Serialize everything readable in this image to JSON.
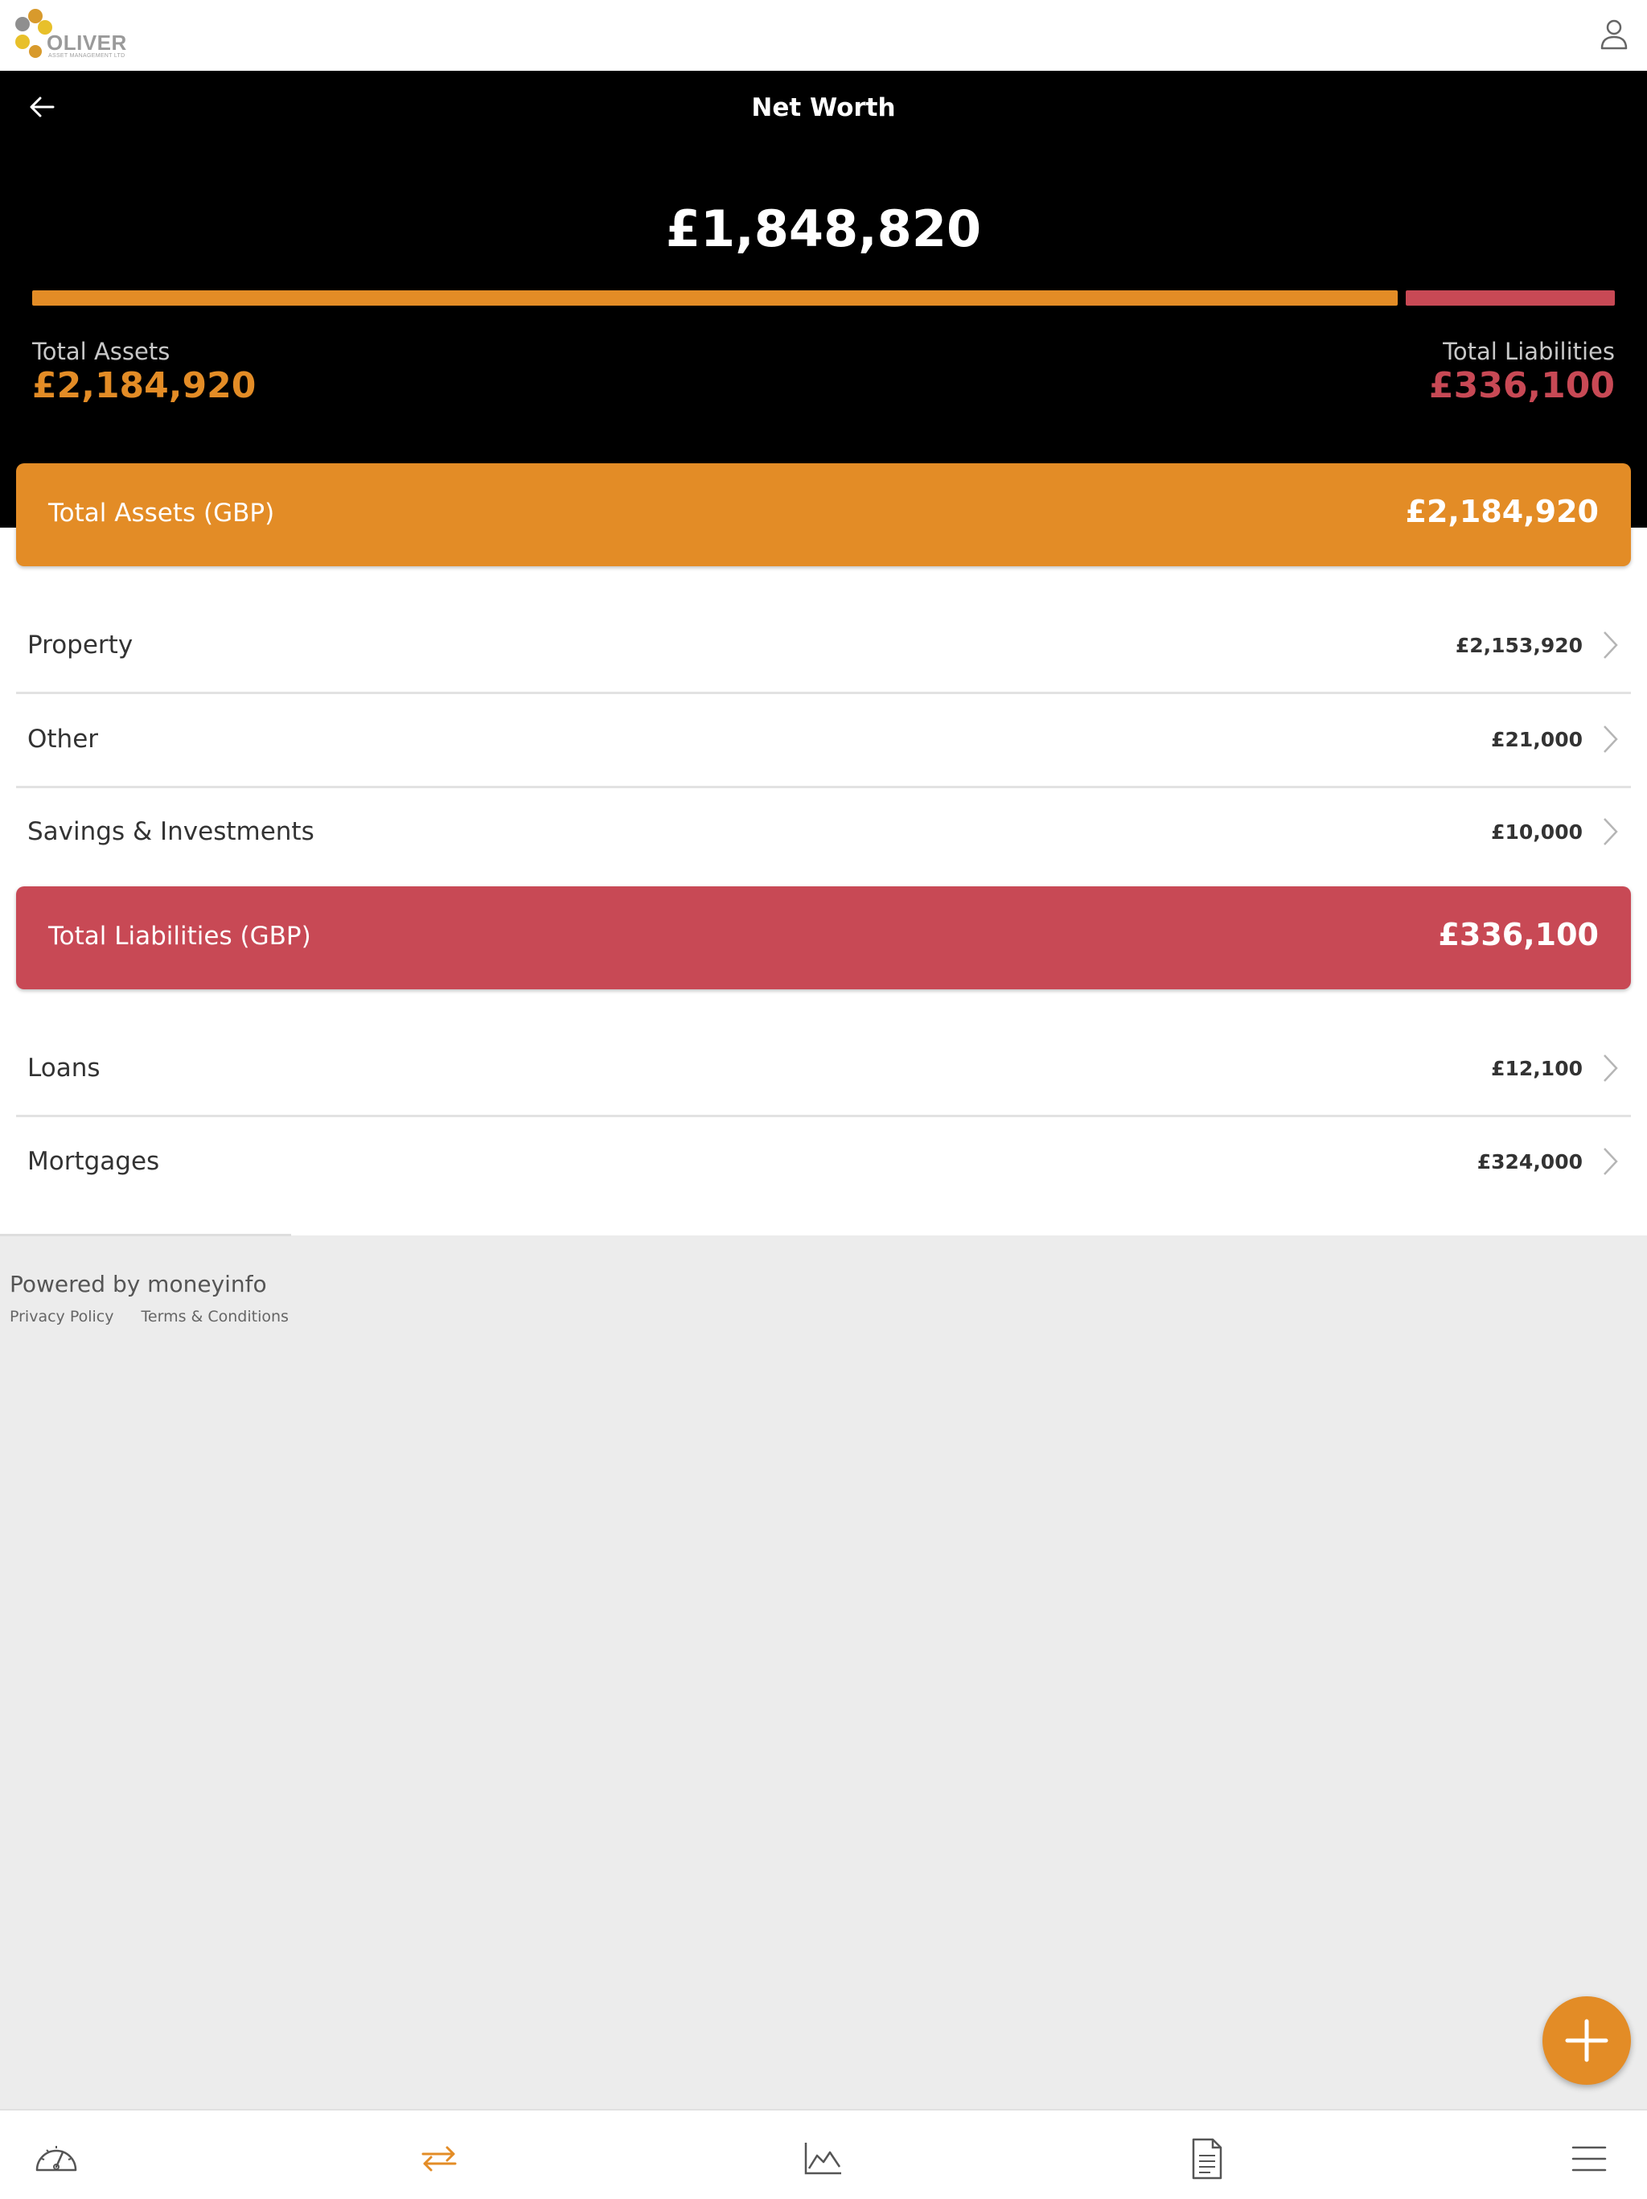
{
  "brand": {
    "logo_word": "OLIVER",
    "logo_sub": "ASSET MANAGEMENT LTD",
    "colors": {
      "assets": "#e38c26",
      "liabilities": "#c84955",
      "header_bg": "#000000"
    }
  },
  "header": {
    "title": "Net Worth",
    "back_icon": "arrow-left-icon",
    "profile_icon": "user-icon"
  },
  "summary": {
    "net_worth": "£1,848,820",
    "assets_share": 0.867,
    "liabilities_share": 0.133,
    "total_assets_label": "Total Assets",
    "total_assets_value": "£2,184,920",
    "total_liabilities_label": "Total Liabilities",
    "total_liabilities_value": "£336,100"
  },
  "assets": {
    "label": "Total Assets (GBP)",
    "value": "£2,184,920",
    "items": [
      {
        "label": "Property",
        "value": "£2,153,920"
      },
      {
        "label": "Other",
        "value": "£21,000"
      },
      {
        "label": "Savings & Investments",
        "value": "£10,000"
      }
    ]
  },
  "liabilities": {
    "label": "Total Liabilities (GBP)",
    "value": "£336,100",
    "items": [
      {
        "label": "Loans",
        "value": "£12,100"
      },
      {
        "label": "Mortgages",
        "value": "£324,000"
      }
    ]
  },
  "footer": {
    "powered_by": "Powered by moneyinfo",
    "privacy": "Privacy Policy",
    "terms": "Terms & Conditions"
  },
  "fab": {
    "icon": "plus-icon"
  },
  "bottom_nav": [
    {
      "icon": "dashboard-gauge-icon",
      "active": false
    },
    {
      "icon": "transfer-arrows-icon",
      "active": true
    },
    {
      "icon": "line-chart-icon",
      "active": false
    },
    {
      "icon": "document-icon",
      "active": false
    },
    {
      "icon": "menu-icon",
      "active": false
    }
  ]
}
